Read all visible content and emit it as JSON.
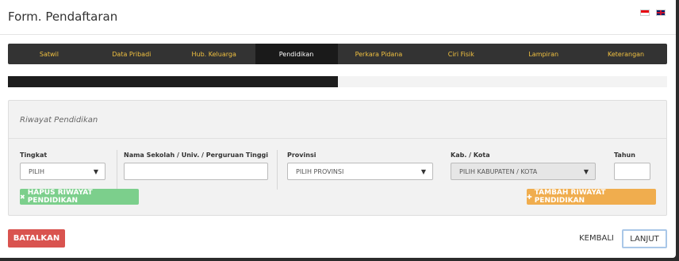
{
  "modal": {
    "title": "Form. Pendaftaran"
  },
  "languages": [
    {
      "icon": "flag-id-icon"
    },
    {
      "icon": "flag-en-icon"
    }
  ],
  "steps": [
    {
      "label": "Satwil",
      "active": false
    },
    {
      "label": "Data Pribadi",
      "active": false
    },
    {
      "label": "Hub. Keluarga",
      "active": false
    },
    {
      "label": "Pendidikan",
      "active": true
    },
    {
      "label": "Perkara Pidana",
      "active": false
    },
    {
      "label": "Ciri Fisik",
      "active": false
    },
    {
      "label": "Lampiran",
      "active": false
    },
    {
      "label": "Keterangan",
      "active": false
    }
  ],
  "progress": {
    "percent": 50
  },
  "panel": {
    "title": "Riwayat Pendidikan",
    "fields": {
      "tingkat": {
        "label": "Tingkat",
        "value": "PILIH"
      },
      "sekolah": {
        "label": "Nama Sekolah / Univ. / Perguruan Tinggi",
        "value": ""
      },
      "provinsi": {
        "label": "Provinsi",
        "value": "PILIH PROVINSI"
      },
      "kota": {
        "label": "Kab. / Kota",
        "value": "PILIH KABUPATEN / KOTA"
      },
      "tahun": {
        "label": "Tahun",
        "value": ""
      }
    },
    "remove_label": "HAPUS RIWAYAT PENDIDIKAN",
    "add_label": "TAMBAH RIWAYAT PENDIDIKAN"
  },
  "footer": {
    "cancel_label": "BATALKAN",
    "back_label": "KEMBALI",
    "next_label": "LANJUT"
  },
  "colors": {
    "accent_text": "#f0c040",
    "nav_bg": "#333333",
    "success": "#7ccf8c",
    "warning": "#f0ad4e",
    "danger": "#d9534f"
  }
}
